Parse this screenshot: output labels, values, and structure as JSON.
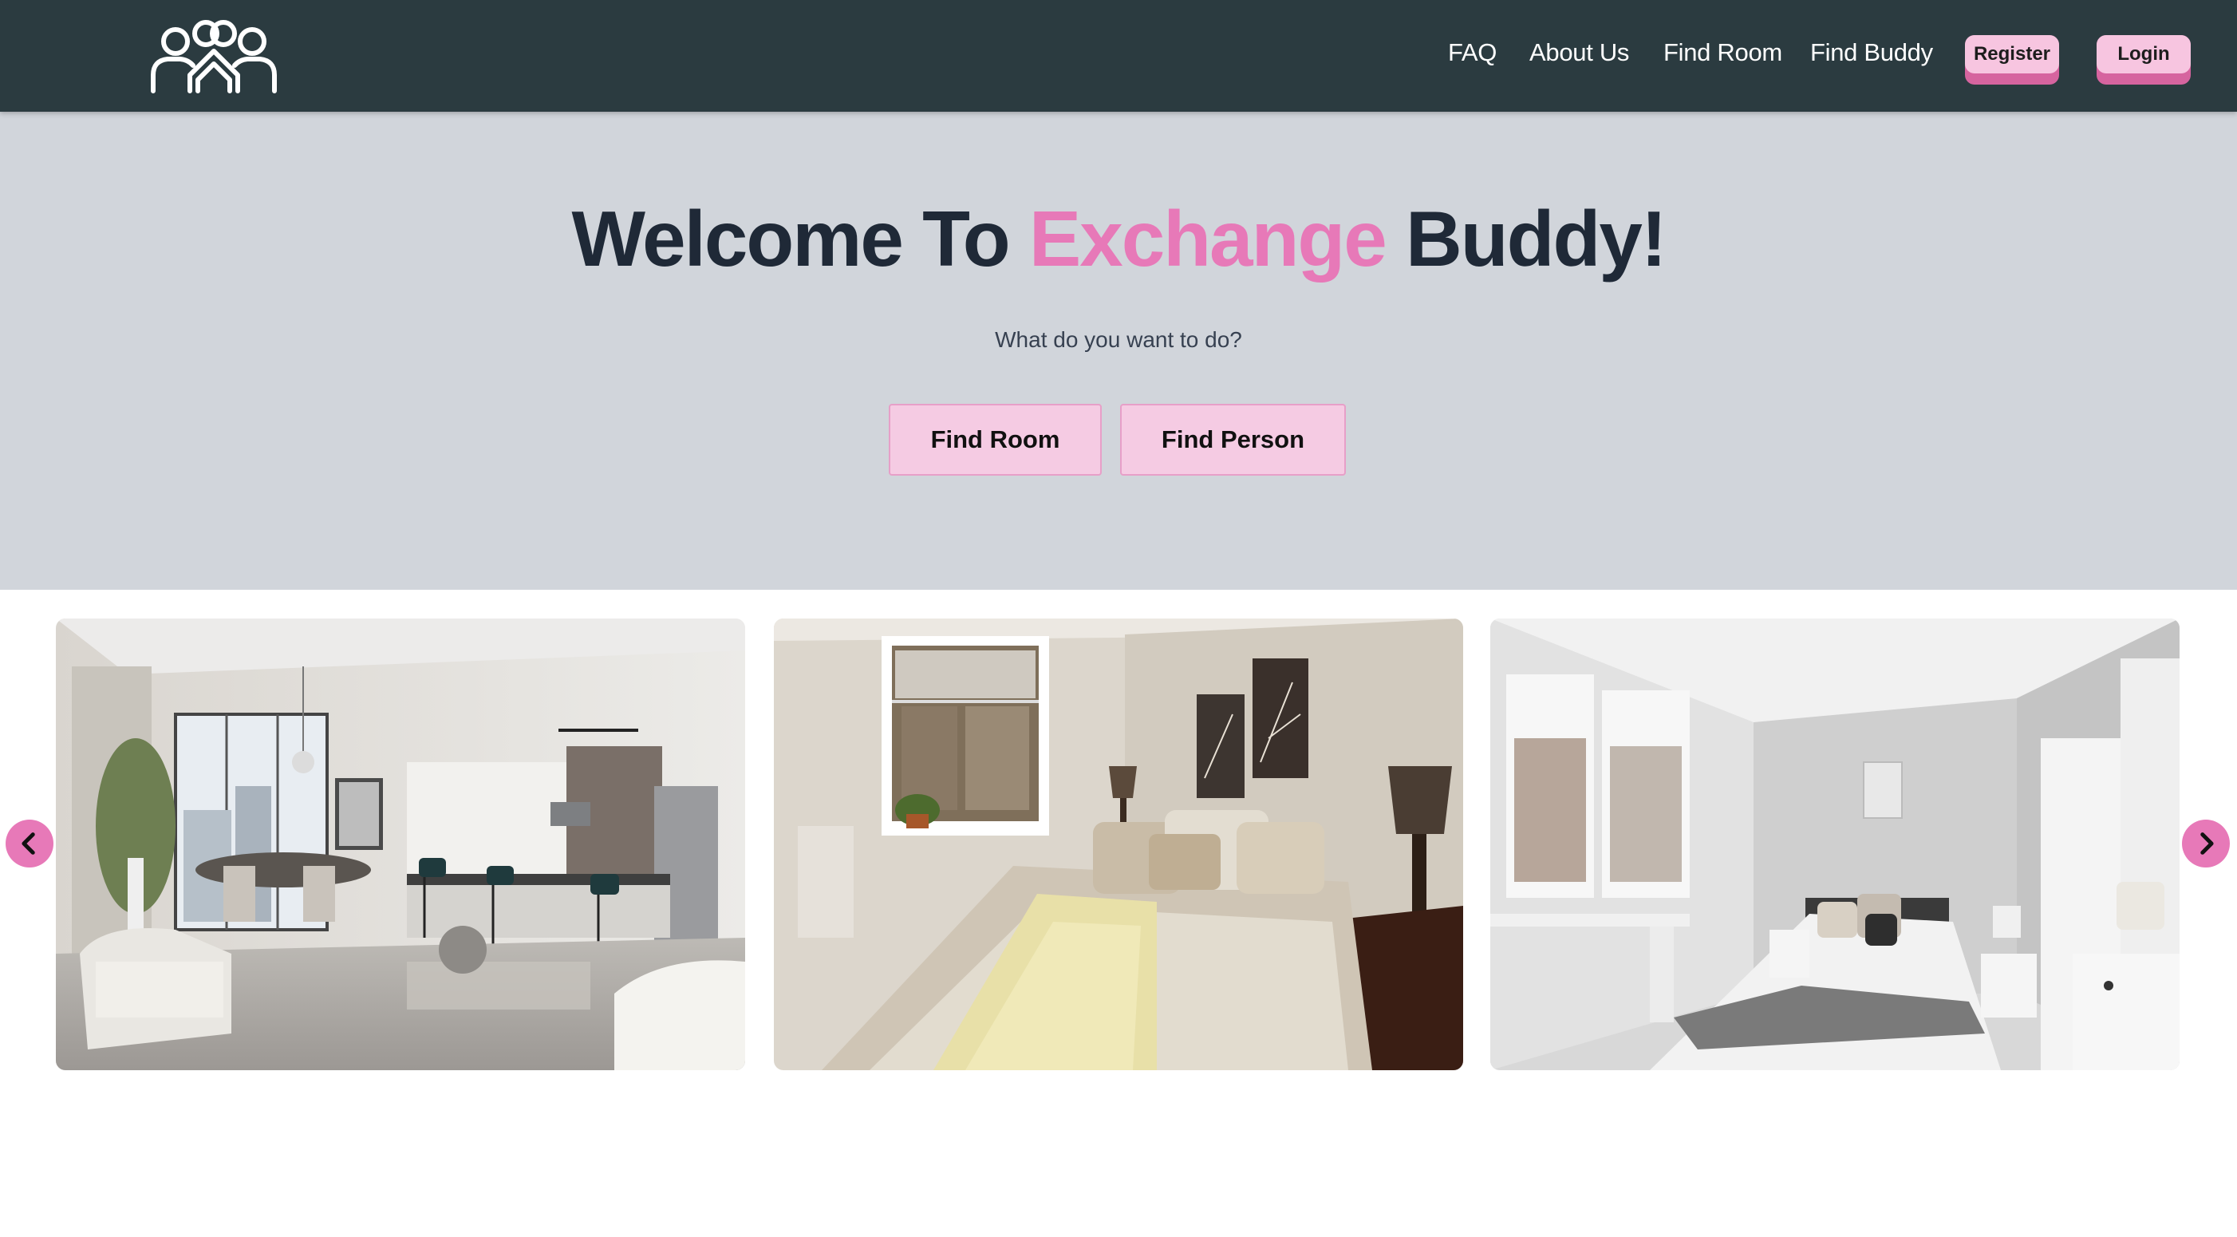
{
  "navbar": {
    "logo_icon": "people-group-icon",
    "links": [
      "FAQ",
      "About Us",
      "Find Room",
      "Find Buddy"
    ],
    "register_label": "Register",
    "login_label": "Login"
  },
  "hero": {
    "title_part1": "Welcome To ",
    "title_accent": "Exchange",
    "title_part2": " Buddy!",
    "subtitle": "What do you want to do?",
    "find_room_label": "Find Room",
    "find_person_label": "Find Person"
  },
  "carousel": {
    "prev_icon": "chevron-left-icon",
    "next_icon": "chevron-right-icon",
    "slides": [
      {
        "name": "room-photo-living-kitchen"
      },
      {
        "name": "room-photo-bedroom-beige"
      },
      {
        "name": "room-photo-bedroom-white"
      }
    ]
  },
  "colors": {
    "navbar_bg": "#2b3b40",
    "accent_pink": "#e779b8",
    "button_pink": "#f5cbe3",
    "hero_bg": "#d1d5db",
    "heading_dark": "#1f2937"
  }
}
